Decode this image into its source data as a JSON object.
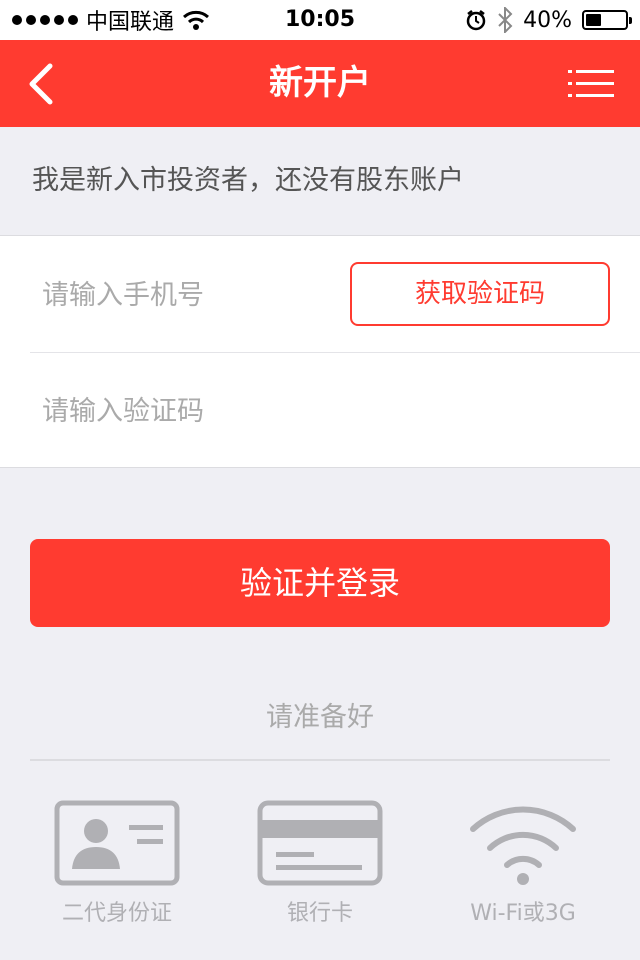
{
  "status_bar": {
    "carrier": "中国联通",
    "time": "10:05",
    "battery_percent_text": "40%",
    "battery_level": 0.4
  },
  "nav": {
    "title": "新开户",
    "back_icon": "chevron-left-icon",
    "menu_icon": "list-menu-icon"
  },
  "section_header": "我是新入市投资者，还没有股东账户",
  "form": {
    "phone_placeholder": "请输入手机号",
    "phone_value": "",
    "get_code_label": "获取验证码",
    "code_placeholder": "请输入验证码",
    "code_value": ""
  },
  "submit_label": "验证并登录",
  "prepare": {
    "title": "请准备好",
    "items": [
      {
        "label": "二代身份证",
        "icon": "id-card-icon"
      },
      {
        "label": "银行卡",
        "icon": "bank-card-icon"
      },
      {
        "label": "Wi-Fi或3G",
        "icon": "wifi-icon"
      }
    ]
  },
  "colors": {
    "accent": "#ff3b30",
    "background": "#efeff4",
    "muted_text": "#aaaaaa",
    "icon_gray": "#b0b0b4"
  }
}
